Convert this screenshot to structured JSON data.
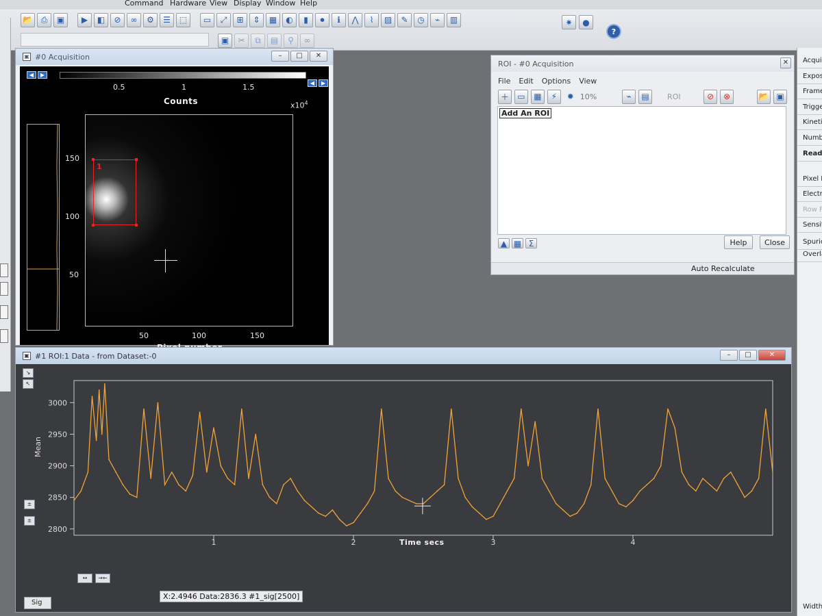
{
  "menu": {
    "items": [
      "Command",
      "Hardware",
      "View",
      "Display",
      "Window",
      "Help"
    ]
  },
  "acquisition_window": {
    "title": "#0  Acquisition",
    "colorbar": {
      "ticks": [
        "0.5",
        "1",
        "1.5"
      ],
      "title": "Counts",
      "multiplier": "x10",
      "multiplier_exp": "4"
    },
    "image": {
      "y_ticks": [
        "150",
        "100",
        "50"
      ],
      "x_ticks": [
        "50",
        "100",
        "150"
      ],
      "xlabel": "Pixel number",
      "roi_label": "1"
    }
  },
  "roi_window": {
    "title": "ROI - #0  Acquisition",
    "menu": [
      "File",
      "Edit",
      "Options",
      "View"
    ],
    "zoom": "10%",
    "roi_select": "ROI",
    "list_item": "Add An ROI",
    "help_label": "Help",
    "close_label": "Close",
    "status": "Auto Recalculate"
  },
  "right_panel": {
    "items": [
      "Acquis",
      "Expos",
      "Frame",
      "Trigge",
      "Kinetic",
      "Numbe",
      "Read",
      "Pixel R",
      "Electr",
      "Row F",
      "Sensit",
      "Spuric",
      "Overla",
      "Width"
    ]
  },
  "plot_window": {
    "title": "#1   ROI:1 Data - from Dataset:-0",
    "tab_label": "Sig",
    "readout": "X:2.4946   Data:2836.3   #1_sig[2500]"
  },
  "chart_data": {
    "type": "line",
    "title": "",
    "xlabel": "Time secs",
    "ylabel": "Mean",
    "xlim": [
      0.0,
      5.0
    ],
    "ylim": [
      2790,
      3035
    ],
    "x_ticks": [
      1,
      2,
      3,
      4
    ],
    "y_ticks": [
      2800,
      2850,
      2900,
      2950,
      3000
    ],
    "series": [
      {
        "color": "#f2a33a",
        "x": [
          0.0,
          0.05,
          0.1,
          0.13,
          0.16,
          0.18,
          0.2,
          0.22,
          0.25,
          0.3,
          0.35,
          0.4,
          0.45,
          0.5,
          0.55,
          0.6,
          0.65,
          0.7,
          0.75,
          0.8,
          0.85,
          0.9,
          0.95,
          1.0,
          1.05,
          1.1,
          1.15,
          1.2,
          1.25,
          1.3,
          1.35,
          1.4,
          1.45,
          1.5,
          1.55,
          1.6,
          1.65,
          1.7,
          1.75,
          1.8,
          1.85,
          1.9,
          1.95,
          2.0,
          2.05,
          2.1,
          2.15,
          2.2,
          2.25,
          2.3,
          2.35,
          2.4,
          2.45,
          2.5,
          2.55,
          2.6,
          2.65,
          2.7,
          2.75,
          2.8,
          2.85,
          2.9,
          2.95,
          3.0,
          3.05,
          3.1,
          3.15,
          3.2,
          3.25,
          3.3,
          3.35,
          3.4,
          3.45,
          3.5,
          3.55,
          3.6,
          3.65,
          3.7,
          3.75,
          3.8,
          3.85,
          3.9,
          3.95,
          4.0,
          4.05,
          4.1,
          4.15,
          4.2,
          4.25,
          4.3,
          4.35,
          4.4,
          4.45,
          4.5,
          4.55,
          4.6,
          4.65,
          4.7,
          4.75,
          4.8,
          4.85,
          4.9,
          4.95,
          5.0
        ],
        "y": [
          2845,
          2860,
          2890,
          3010,
          2940,
          3020,
          2950,
          3030,
          2910,
          2890,
          2870,
          2855,
          2850,
          2990,
          2880,
          3000,
          2870,
          2890,
          2870,
          2860,
          2885,
          2985,
          2890,
          2960,
          2900,
          2880,
          2870,
          2990,
          2880,
          2950,
          2870,
          2850,
          2840,
          2870,
          2880,
          2860,
          2845,
          2835,
          2825,
          2820,
          2830,
          2815,
          2805,
          2810,
          2825,
          2840,
          2860,
          2990,
          2880,
          2860,
          2850,
          2845,
          2840,
          2840,
          2850,
          2860,
          2870,
          2990,
          2880,
          2850,
          2835,
          2825,
          2815,
          2820,
          2840,
          2860,
          2880,
          2990,
          2900,
          2970,
          2880,
          2860,
          2840,
          2830,
          2820,
          2825,
          2840,
          2870,
          2990,
          2880,
          2860,
          2840,
          2835,
          2845,
          2860,
          2870,
          2880,
          2900,
          2990,
          2960,
          2890,
          2870,
          2860,
          2880,
          2870,
          2860,
          2880,
          2890,
          2870,
          2850,
          2860,
          2880,
          2990,
          2890
        ]
      }
    ]
  }
}
